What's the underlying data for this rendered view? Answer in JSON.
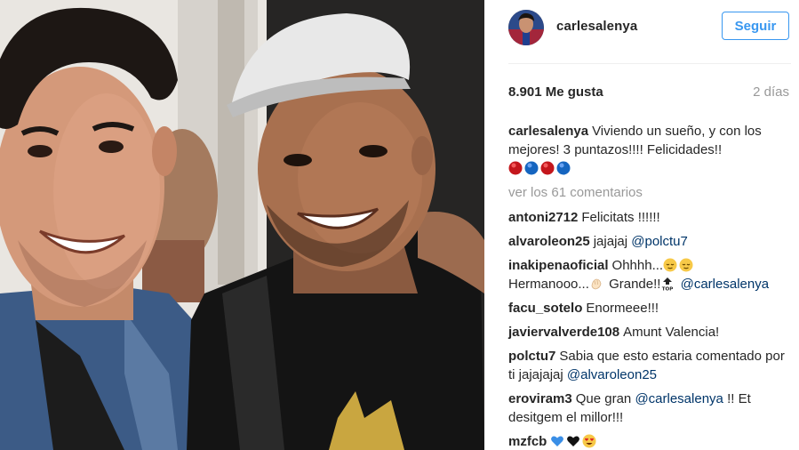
{
  "post": {
    "username": "carlesalenya",
    "follow_label": "Seguir",
    "likes": "8.901 Me gusta",
    "time_ago": "2 días"
  },
  "caption": {
    "user": "carlesalenya",
    "text": "Viviendo un sueño, y con los mejores! 3 puntazos!!!! Felicidades!!",
    "emojis": [
      "red-circle-icon",
      "blue-circle-icon",
      "red-circle-icon",
      "blue-circle-icon"
    ]
  },
  "view_all_label": "ver los 61 comentarios",
  "comments": [
    {
      "user": "antoni2712",
      "text": "Felicitats !!!!!!"
    },
    {
      "user": "alvaroleon25",
      "text": "jajajaj",
      "mention": "@polctu7"
    },
    {
      "user": "inakipenaoficial",
      "text_1": "Ohhhh...",
      "text_2": "Hermanooo...",
      "text_3": "Grande!!",
      "mention": "@carlesalenya"
    },
    {
      "user": "facu_sotelo",
      "text": "Enormeee!!!"
    },
    {
      "user": "javiervalverde108",
      "text": "Amunt Valencia!"
    },
    {
      "user": "polctu7",
      "text": "Sabia que esto estaria comentado por ti jajajajaj",
      "mention": "@alvaroleon25"
    },
    {
      "user": "eroviram3",
      "text_1": "Que gran",
      "mention": "@carlesalenya",
      "text_2": "!! Et desitgem el millor!!!"
    },
    {
      "user": "mzfcb",
      "emojis": [
        "blue-heart-icon",
        "black-heart-icon",
        "heart-eyes-icon"
      ]
    }
  ],
  "colors": {
    "accent_blue": "#3897f0",
    "mention_blue": "#003569",
    "muted_gray": "#999999",
    "text": "#262626"
  }
}
